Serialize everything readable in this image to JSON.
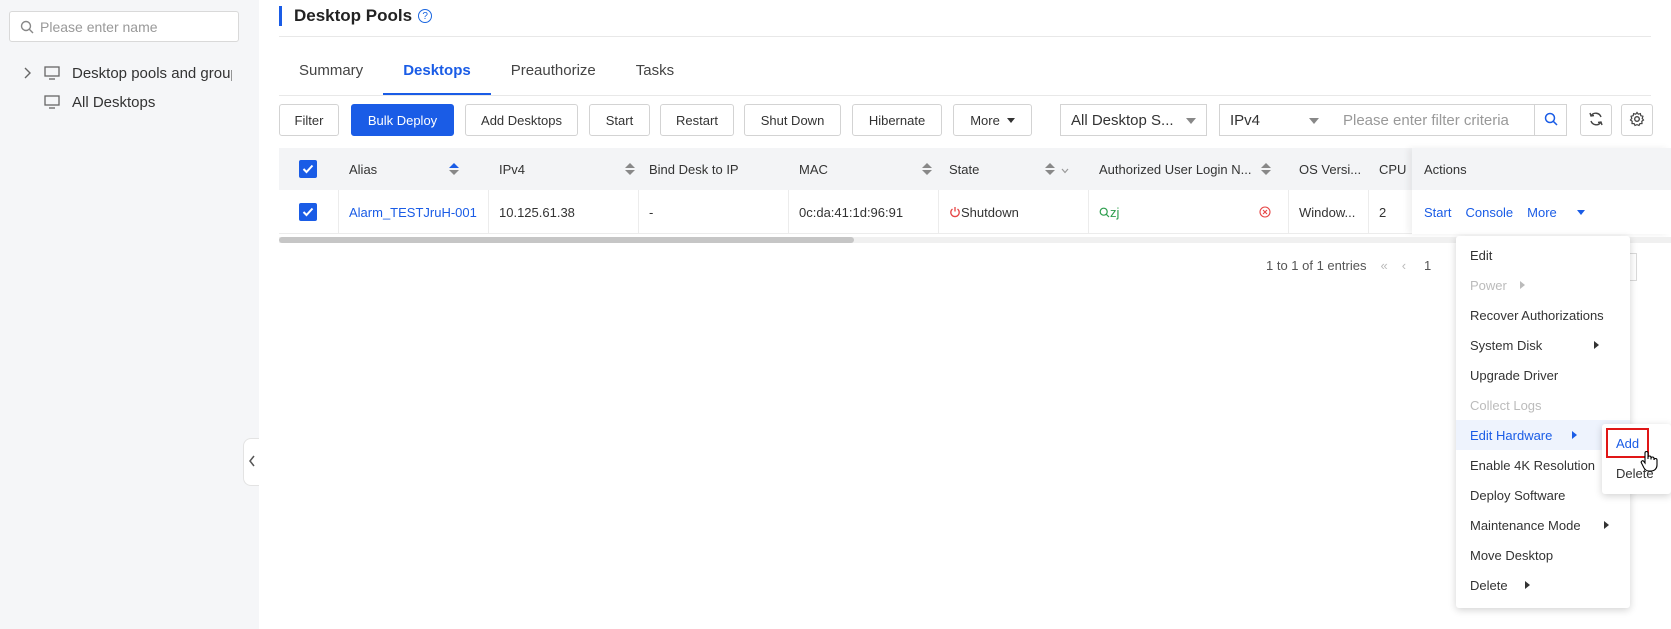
{
  "sidebar": {
    "search_placeholder": "Please enter name",
    "tree": [
      {
        "label": "Desktop pools and groups",
        "icon": "monitor-icon",
        "expandable": true
      },
      {
        "label": "All Desktops",
        "icon": "monitor-icon",
        "expandable": false
      }
    ]
  },
  "header": {
    "title": "Desktop Pools"
  },
  "tabs": [
    {
      "label": "Summary",
      "active": false
    },
    {
      "label": "Desktops",
      "active": true
    },
    {
      "label": "Preauthorize",
      "active": false
    },
    {
      "label": "Tasks",
      "active": false
    }
  ],
  "toolbar": {
    "filter": "Filter",
    "bulk_deploy": "Bulk Deploy",
    "add_desktops": "Add Desktops",
    "start": "Start",
    "restart": "Restart",
    "shut_down": "Shut Down",
    "hibernate": "Hibernate",
    "more": "More",
    "scope_select": "All Desktop S...",
    "ip_select": "IPv4",
    "filter_placeholder": "Please enter filter criteria"
  },
  "table": {
    "columns": [
      "Alias",
      "IPv4",
      "Bind Desk to IP",
      "MAC",
      "State",
      "Authorized User Login N...",
      "OS Versi...",
      "CPU",
      "Actions"
    ],
    "rows": [
      {
        "alias": "Alarm_TESTJruH-001",
        "ipv4": "10.125.61.38",
        "bind_ip": "-",
        "mac": "0c:da:41:1d:96:91",
        "state": "Shutdown",
        "user": "zj",
        "os": "Window...",
        "cpu": "2",
        "actions": [
          "Start",
          "Console",
          "More"
        ]
      }
    ]
  },
  "pagination": {
    "summary": "1 to 1 of 1 entries",
    "page": "1"
  },
  "context_menu": {
    "items": [
      {
        "label": "Edit",
        "disabled": false,
        "submenu": false
      },
      {
        "label": "Power",
        "disabled": true,
        "submenu": true
      },
      {
        "label": "Recover Authorizations",
        "disabled": false,
        "submenu": false
      },
      {
        "label": "System Disk",
        "disabled": false,
        "submenu": true
      },
      {
        "label": "Upgrade Driver",
        "disabled": false,
        "submenu": false
      },
      {
        "label": "Collect Logs",
        "disabled": true,
        "submenu": false
      },
      {
        "label": "Edit Hardware",
        "disabled": false,
        "submenu": true,
        "hover": true
      },
      {
        "label": "Enable 4K Resolution",
        "disabled": false,
        "submenu": false
      },
      {
        "label": "Deploy Software",
        "disabled": false,
        "submenu": false
      },
      {
        "label": "Maintenance Mode",
        "disabled": false,
        "submenu": true
      },
      {
        "label": "Move Desktop",
        "disabled": false,
        "submenu": false
      },
      {
        "label": "Delete",
        "disabled": false,
        "submenu": true
      }
    ],
    "edit_hardware_submenu": [
      "Add",
      "Delete"
    ]
  },
  "colors": {
    "accent": "#1a5ce6",
    "state_shutdown": "#e64545",
    "user_online": "#2e9e4e",
    "highlight": "#e01616"
  }
}
